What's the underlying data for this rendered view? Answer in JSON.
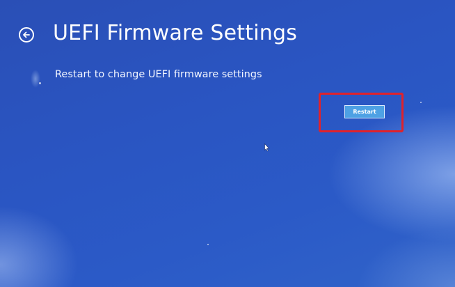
{
  "page": {
    "title": "UEFI Firmware Settings",
    "description": "Restart to change UEFI firmware settings"
  },
  "actions": {
    "restart_label": "Restart"
  },
  "icons": {
    "back": "back-arrow-icon",
    "cursor": "mouse-pointer-icon"
  },
  "colors": {
    "background": "#2a55c2",
    "button_fill": "#4ea1e4",
    "highlight": "#e0222b",
    "text": "#ffffff"
  }
}
